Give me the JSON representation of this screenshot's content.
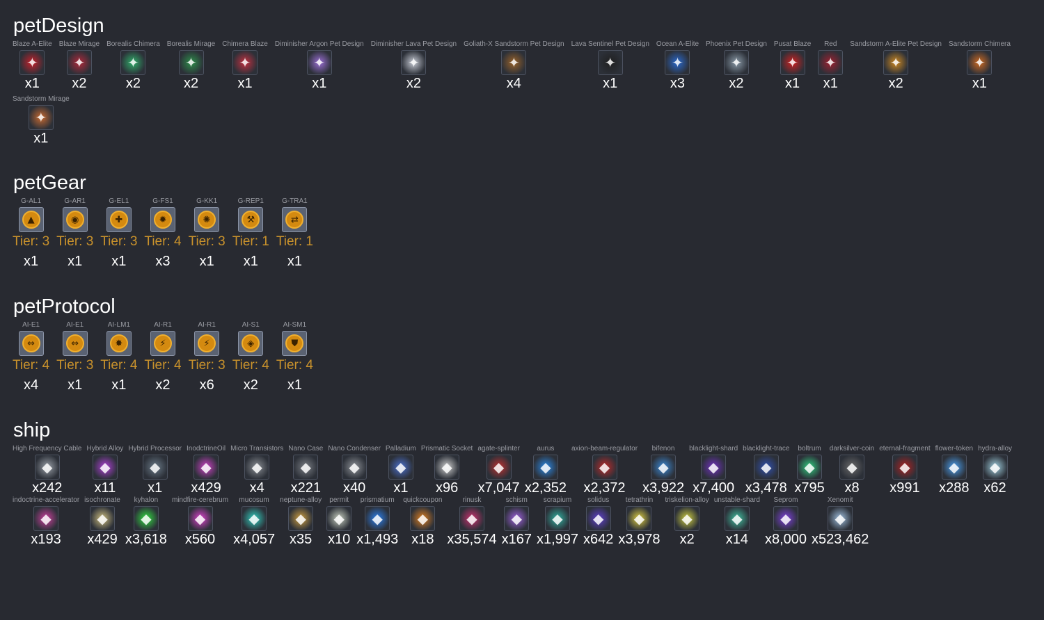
{
  "sections": {
    "petDesign": {
      "title": "petDesign",
      "items": [
        {
          "label": "Blaze A-Elite",
          "count": "x1",
          "icon": "red-drone",
          "color": "#c8202a"
        },
        {
          "label": "Blaze Mirage",
          "count": "x2",
          "icon": "red-ship",
          "color": "#b0283a"
        },
        {
          "label": "Borealis Chimera",
          "count": "x2",
          "icon": "green-ship",
          "color": "#2fae6a"
        },
        {
          "label": "Borealis Mirage",
          "count": "x2",
          "icon": "green-ship",
          "color": "#2d8f4a"
        },
        {
          "label": "Chimera Blaze",
          "count": "x1",
          "icon": "red-ship",
          "color": "#c43040"
        },
        {
          "label": "Diminisher Argon Pet Design",
          "count": "x1",
          "icon": "purple-ship",
          "color": "#9b6fd6"
        },
        {
          "label": "Diminisher Lava Pet Design",
          "count": "x2",
          "icon": "white-ship",
          "color": "#c8ccd6"
        },
        {
          "label": "Goliath-X Sandstorm Pet Design",
          "count": "x4",
          "icon": "brown-ship",
          "color": "#9a6228"
        },
        {
          "label": "Lava Sentinel Pet Design",
          "count": "x1",
          "icon": "black-ship",
          "color": "#202020"
        },
        {
          "label": "Ocean A-Elite",
          "count": "x3",
          "icon": "blue-drone",
          "color": "#2a6ad0"
        },
        {
          "label": "Phoenix Pet Design",
          "count": "x2",
          "icon": "grey-pod",
          "color": "#8a9aa8"
        },
        {
          "label": "Pusat Blaze",
          "count": "x1",
          "icon": "red-ship",
          "color": "#d02020"
        },
        {
          "label": "Red",
          "count": "x1",
          "icon": "red-ship",
          "color": "#a02030"
        },
        {
          "label": "Sandstorm A-Elite Pet Design",
          "count": "x2",
          "icon": "orange-drone",
          "color": "#d08a20"
        },
        {
          "label": "Sandstorm Chimera",
          "count": "x1",
          "icon": "orange-ship",
          "color": "#d06a20"
        },
        {
          "label": "Sandstorm Mirage",
          "count": "x1",
          "icon": "orange-ship",
          "color": "#c86a30"
        }
      ]
    },
    "petGear": {
      "title": "petGear",
      "items": [
        {
          "label": "G-AL1",
          "tier": "Tier: 3",
          "count": "x1",
          "icon": "gear-chip-icon"
        },
        {
          "label": "G-AR1",
          "tier": "Tier: 3",
          "count": "x1",
          "icon": "gear-chip-icon"
        },
        {
          "label": "G-EL1",
          "tier": "Tier: 3",
          "count": "x1",
          "icon": "gear-chip-icon"
        },
        {
          "label": "G-FS1",
          "tier": "Tier: 4",
          "count": "x3",
          "icon": "gear-chip-icon"
        },
        {
          "label": "G-KK1",
          "tier": "Tier: 3",
          "count": "x1",
          "icon": "gear-chip-icon"
        },
        {
          "label": "G-REP1",
          "tier": "Tier: 1",
          "count": "x1",
          "icon": "gear-chip-icon"
        },
        {
          "label": "G-TRA1",
          "tier": "Tier: 1",
          "count": "x1",
          "icon": "gear-chip-icon"
        }
      ]
    },
    "petProtocol": {
      "title": "petProtocol",
      "items": [
        {
          "label": "AI-E1",
          "tier": "Tier: 4",
          "count": "x4",
          "icon": "protocol-chip-icon"
        },
        {
          "label": "AI-E1",
          "tier": "Tier: 3",
          "count": "x1",
          "icon": "protocol-chip-icon"
        },
        {
          "label": "AI-LM1",
          "tier": "Tier: 4",
          "count": "x1",
          "icon": "protocol-chip-icon"
        },
        {
          "label": "AI-R1",
          "tier": "Tier: 4",
          "count": "x2",
          "icon": "protocol-chip-icon"
        },
        {
          "label": "AI-R1",
          "tier": "Tier: 3",
          "count": "x6",
          "icon": "protocol-chip-icon"
        },
        {
          "label": "AI-S1",
          "tier": "Tier: 4",
          "count": "x2",
          "icon": "protocol-chip-icon"
        },
        {
          "label": "AI-SM1",
          "tier": "Tier: 4",
          "count": "x1",
          "icon": "protocol-chip-icon"
        }
      ]
    },
    "ship": {
      "title": "ship",
      "items": [
        {
          "label": "High Frequency Cable",
          "count": "x242",
          "color": "#9aa0a8"
        },
        {
          "label": "Hybrid Alloy",
          "count": "x11",
          "color": "#b040d8"
        },
        {
          "label": "Hybrid Processor",
          "count": "x1",
          "color": "#6a7a88"
        },
        {
          "label": "InodctrineOil",
          "count": "x429",
          "color": "#d040c8"
        },
        {
          "label": "Micro Transistors",
          "count": "x4",
          "color": "#8a8e94"
        },
        {
          "label": "Nano Case",
          "count": "x221",
          "color": "#7a7e84"
        },
        {
          "label": "Nano Condenser",
          "count": "x40",
          "color": "#8e9298"
        },
        {
          "label": "Palladium",
          "count": "x1",
          "color": "#4a70d0"
        },
        {
          "label": "Prismatic Socket",
          "count": "x96",
          "color": "#d0d0d0"
        },
        {
          "label": "agate-splinter",
          "count": "x7,047",
          "color": "#c03030"
        },
        {
          "label": "aurus",
          "count": "x2,352",
          "color": "#2a8ae8"
        },
        {
          "label": "axion-beam-regulator",
          "count": "x2,372",
          "color": "#c02a2a"
        },
        {
          "label": "bifenon",
          "count": "x3,922",
          "color": "#3a8ad8"
        },
        {
          "label": "blacklight-shard",
          "count": "x7,400",
          "color": "#7030c0"
        },
        {
          "label": "blacklight-trace",
          "count": "x3,478",
          "color": "#3050b0"
        },
        {
          "label": "boltrum",
          "count": "x795",
          "color": "#30d080"
        },
        {
          "label": "darksilver-coin",
          "count": "x8",
          "color": "#6a6a6a"
        },
        {
          "label": "eternal-fragment",
          "count": "x991",
          "color": "#b02020"
        },
        {
          "label": "flower-token",
          "count": "x288",
          "color": "#4aa0f0"
        },
        {
          "label": "hydra-alloy",
          "count": "x62",
          "color": "#a0d0e0"
        },
        {
          "label": "indoctrine-accelerator",
          "count": "x193",
          "color": "#d040a0"
        },
        {
          "label": "isochronate",
          "count": "x429",
          "color": "#d0c080"
        },
        {
          "label": "kyhalon",
          "count": "x3,618",
          "color": "#30e040"
        },
        {
          "label": "mindfire-cerebrum",
          "count": "x560",
          "color": "#e040d0"
        },
        {
          "label": "mucosum",
          "count": "x4,057",
          "color": "#30d0c0"
        },
        {
          "label": "neptune-alloy",
          "count": "x35",
          "color": "#d0a040"
        },
        {
          "label": "permit",
          "count": "x10",
          "color": "#c8d0c0"
        },
        {
          "label": "prismatium",
          "count": "x1,493",
          "color": "#2a80f0"
        },
        {
          "label": "quickcoupon",
          "count": "x18",
          "color": "#e08020"
        },
        {
          "label": "rinusk",
          "count": "x35,574",
          "color": "#d03070"
        },
        {
          "label": "schism",
          "count": "x167",
          "color": "#a060e0"
        },
        {
          "label": "scrapium",
          "count": "x1,997",
          "color": "#30b0a0"
        },
        {
          "label": "solidus",
          "count": "x642",
          "color": "#6040d0"
        },
        {
          "label": "tetrathrin",
          "count": "x3,978",
          "color": "#e0d040"
        },
        {
          "label": "triskelion-alloy",
          "count": "x2",
          "color": "#d0d040"
        },
        {
          "label": "unstable-shard",
          "count": "x14",
          "color": "#40c0a0"
        },
        {
          "label": "Seprom",
          "count": "x8,000",
          "color": "#8040e0"
        },
        {
          "label": "Xenomit",
          "count": "x523,462",
          "color": "#a0c0e0"
        }
      ]
    }
  }
}
